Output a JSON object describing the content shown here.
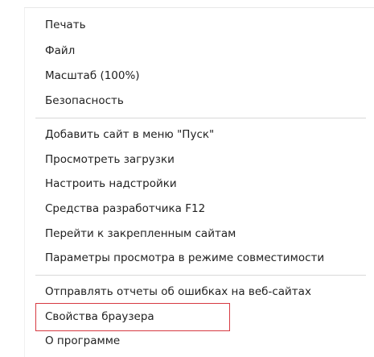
{
  "menu": {
    "group1": [
      "Печать",
      "Файл",
      "Масштаб (100%)",
      "Безопасность"
    ],
    "group2": [
      "Добавить сайт в меню \"Пуск\"",
      "Просмотреть загрузки",
      "Настроить надстройки",
      "Средства разработчика F12",
      "Перейти к закрепленным сайтам",
      "Параметры просмотра в режиме совместимости"
    ],
    "group3": [
      "Отправлять отчеты об ошибках на веб-сайтах",
      "Свойства браузера",
      "О программе"
    ]
  },
  "colors": {
    "highlight_border": "#d73a42",
    "separator": "#d9d9d9",
    "text": "#222222"
  }
}
